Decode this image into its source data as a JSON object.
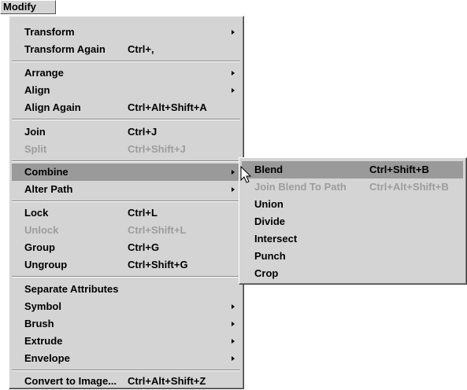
{
  "menubar": {
    "title": "Modify"
  },
  "main_menu": {
    "transform": {
      "label": "Transform"
    },
    "transform_again": {
      "label": "Transform Again",
      "shortcut": "Ctrl+,"
    },
    "arrange": {
      "label": "Arrange"
    },
    "align": {
      "label": "Align"
    },
    "align_again": {
      "label": "Align Again",
      "shortcut": "Ctrl+Alt+Shift+A"
    },
    "join": {
      "label": "Join",
      "shortcut": "Ctrl+J"
    },
    "split": {
      "label": "Split",
      "shortcut": "Ctrl+Shift+J"
    },
    "combine": {
      "label": "Combine"
    },
    "alter_path": {
      "label": "Alter Path"
    },
    "lock": {
      "label": "Lock",
      "shortcut": "Ctrl+L"
    },
    "unlock": {
      "label": "Unlock",
      "shortcut": "Ctrl+Shift+L"
    },
    "group": {
      "label": "Group",
      "shortcut": "Ctrl+G"
    },
    "ungroup": {
      "label": "Ungroup",
      "shortcut": "Ctrl+Shift+G"
    },
    "separate_attributes": {
      "label": "Separate Attributes"
    },
    "symbol": {
      "label": "Symbol"
    },
    "brush": {
      "label": "Brush"
    },
    "extrude": {
      "label": "Extrude"
    },
    "envelope": {
      "label": "Envelope"
    },
    "convert_to_image": {
      "label": "Convert to Image...",
      "shortcut": "Ctrl+Alt+Shift+Z"
    }
  },
  "combine_submenu": {
    "blend": {
      "label": "Blend",
      "shortcut": "Ctrl+Shift+B"
    },
    "join_blend_to_path": {
      "label": "Join Blend To Path",
      "shortcut": "Ctrl+Alt+Shift+B"
    },
    "union": {
      "label": "Union"
    },
    "divide": {
      "label": "Divide"
    },
    "intersect": {
      "label": "Intersect"
    },
    "punch": {
      "label": "Punch"
    },
    "crop": {
      "label": "Crop"
    }
  },
  "colors": {
    "menu_bg": "#d4d4d4",
    "highlight": "#9a9a9a",
    "disabled_text": "#9c9c9c"
  }
}
